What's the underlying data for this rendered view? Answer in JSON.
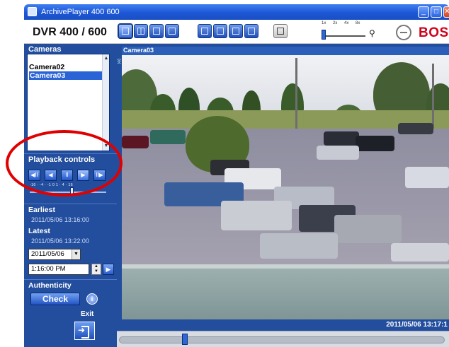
{
  "window": {
    "title": "ArchivePlayer 400 600",
    "controls": [
      "minimize-icon",
      "maximize-icon",
      "close-icon"
    ]
  },
  "toolbar": {
    "product_name": "DVR 400 / 600",
    "layout_buttons": [
      "single-view-icon",
      "quad-view-icon",
      "nine-view-icon",
      "sixteen-view-icon"
    ],
    "tool_buttons": [
      "export-icon",
      "print-icon",
      "audio-icon",
      "edit-icon",
      "snapshot-icon"
    ],
    "speed_labels": [
      "1x",
      "2x",
      "4x",
      "8x"
    ],
    "zoom_icon": "magnifier-icon",
    "brand": "BOSCH"
  },
  "sidebar": {
    "cameras_title": "Cameras",
    "cameras": [
      {
        "label": "Camera02",
        "selected": false
      },
      {
        "label": "Camera03",
        "selected": true
      }
    ],
    "playback_title": "Playback controls",
    "playback_buttons": [
      {
        "icon": "step-back-icon",
        "glyph": "◀II"
      },
      {
        "icon": "play-reverse-icon",
        "glyph": "◀"
      },
      {
        "icon": "pause-icon",
        "glyph": "II"
      },
      {
        "icon": "play-icon",
        "glyph": "▶"
      },
      {
        "icon": "step-forward-icon",
        "glyph": "II▶"
      }
    ],
    "speed_scale": "-16 · -4 · -1 0 1 · 4 · 16",
    "earliest_label": "Earliest",
    "earliest_value": "2011/05/06 13:16:00",
    "latest_label": "Latest",
    "latest_value": "2011/05/06 13:22:00",
    "date_value": "2011/05/06",
    "time_value": "1:16:00 PM",
    "authenticity_title": "Authenticity",
    "check_label": "Check",
    "info_glyph": "i",
    "exit_label": "Exit"
  },
  "video": {
    "camera_label": "Camera03",
    "timestamp": "2011/05/06 13:17:1"
  },
  "colors": {
    "panel_blue": "#234e9e",
    "title_blue": "#1d57d6",
    "brand_red": "#d0021b",
    "annotation_red": "#e00000"
  }
}
